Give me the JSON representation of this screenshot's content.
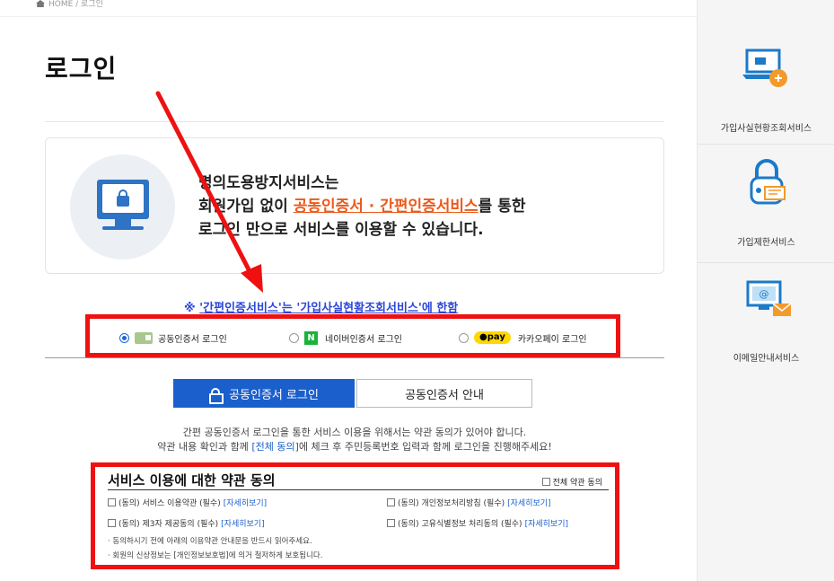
{
  "breadcrumb": {
    "text": "HOME / 로그인"
  },
  "page": {
    "title": "로그인"
  },
  "info": {
    "line1": "명의도용방지서비스는",
    "line2_pre": "회원가입 없이 ",
    "line2_highlight": "공동인증서 · 간편인증서비스",
    "line2_post": "를 통한",
    "line3": "로그인 만으로 서비스를 이용할 수 있습니다."
  },
  "notice": {
    "prefix": "※ ",
    "text": "'간편인증서비스'는 '가입사실현황조회서비스'에 한함"
  },
  "login_options": [
    {
      "label": "공동인증서 로그인",
      "selected": true,
      "badge": ""
    },
    {
      "label": "네이버인증서 로그인",
      "selected": false,
      "badge": "N"
    },
    {
      "label": "카카오페이 로그인",
      "selected": false,
      "badge": "●pay"
    }
  ],
  "tabs": {
    "active": "공동인증서 로그인",
    "inactive": "공동인증서 안내"
  },
  "description": {
    "line1": "간편 공동인증서 로그인을 통한 서비스 이용을 위해서는 약관 동의가 있어야 합니다.",
    "line2_pre": "약관 내용 확인과 함께 ",
    "line2_link": "[전체 동의]",
    "line2_post": "에 체크 후 주민등록번호 입력과 함께 로그인을 진행해주세요!"
  },
  "terms": {
    "title": "서비스 이용에 대한 약관 동의",
    "all_agree": "전체 약관 동의",
    "items": [
      {
        "label": "(동의) 서비스 이용약관 (필수)",
        "more": "[자세히보기]"
      },
      {
        "label": "(동의) 개인정보처리방침 (필수)",
        "more": "[자세히보기]"
      },
      {
        "label": "(동의) 제3자 제공동의 (필수)",
        "more": "[자세히보기]"
      },
      {
        "label": "(동의) 고유식별정보 처리동의 (필수)",
        "more": "[자세히보기]"
      }
    ],
    "notes": [
      "· 동의하시기 전에 아래의 이용약관 안내문을 반드시 읽어주세요.",
      "· 회원의 신상정보는 [개인정보보호법]에 의거 철저하게 보호됩니다."
    ]
  },
  "sidebar": {
    "items": [
      {
        "label": "가입사실현황조회서비스",
        "icon": "laptop-search-icon"
      },
      {
        "label": "가입제한서비스",
        "icon": "lock-card-icon"
      },
      {
        "label": "이메일안내서비스",
        "icon": "monitor-mail-icon"
      }
    ]
  },
  "colors": {
    "accent_blue": "#1b5fcc",
    "highlight_orange": "#ea5a1c",
    "annotation_red": "#ef1111"
  }
}
